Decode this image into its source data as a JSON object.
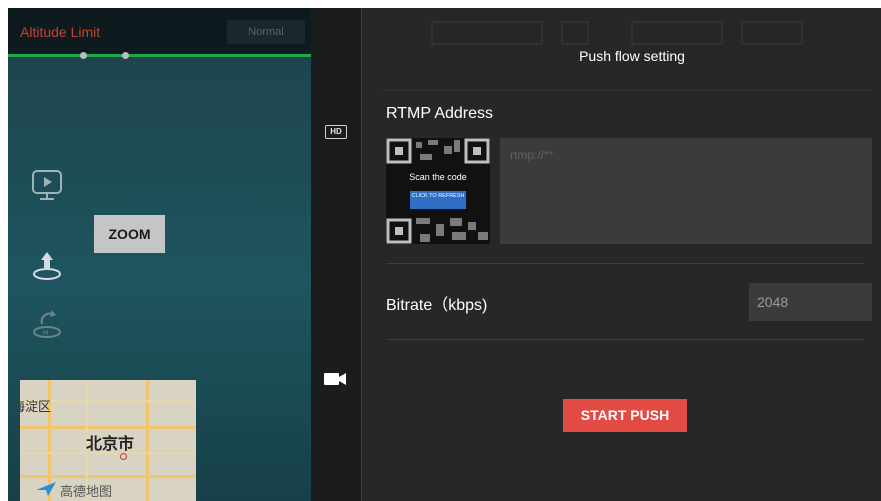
{
  "camera": {
    "altitude_label": "Altitude Limit",
    "mode_label": "Normal",
    "zoom_label": "ZOOM"
  },
  "map": {
    "district": "海淀区",
    "city": "北京市",
    "watermark": "高德地图"
  },
  "strip": {
    "hd_label": "HD"
  },
  "panel": {
    "title": "Push flow setting",
    "rtmp_label": "RTMP Address",
    "qr_scan_text": "Scan the code",
    "qr_refresh_label": "CLICK TO REFRESH",
    "rtmp_placeholder": "rtmp://**",
    "bitrate_label": "Bitrate（kbps)",
    "bitrate_value": "2048",
    "start_label": "START PUSH"
  },
  "colors": {
    "start_button": "#e24a44",
    "refresh_button": "#2f6ec4",
    "altitude_text": "#c9402f",
    "status_line": "#1fa84a"
  }
}
